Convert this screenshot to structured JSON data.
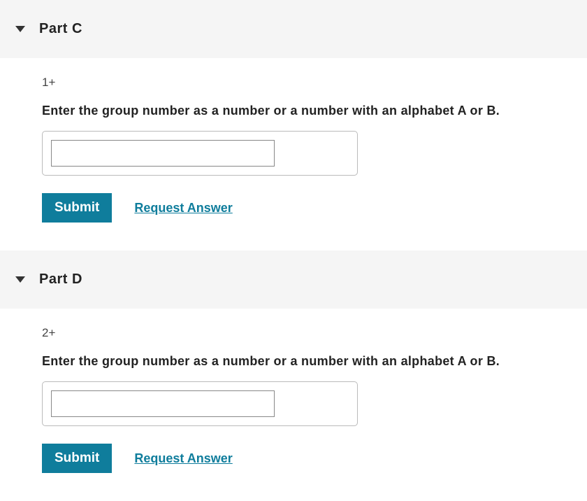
{
  "parts": [
    {
      "title": "Part C",
      "prompt": "1+",
      "instruction": "Enter the group number as a number or a number with an alphabet A or B.",
      "submit_label": "Submit",
      "request_label": "Request Answer"
    },
    {
      "title": "Part D",
      "prompt": "2+",
      "instruction": "Enter the group number as a number or a number with an alphabet A or B.",
      "submit_label": "Submit",
      "request_label": "Request Answer"
    }
  ]
}
